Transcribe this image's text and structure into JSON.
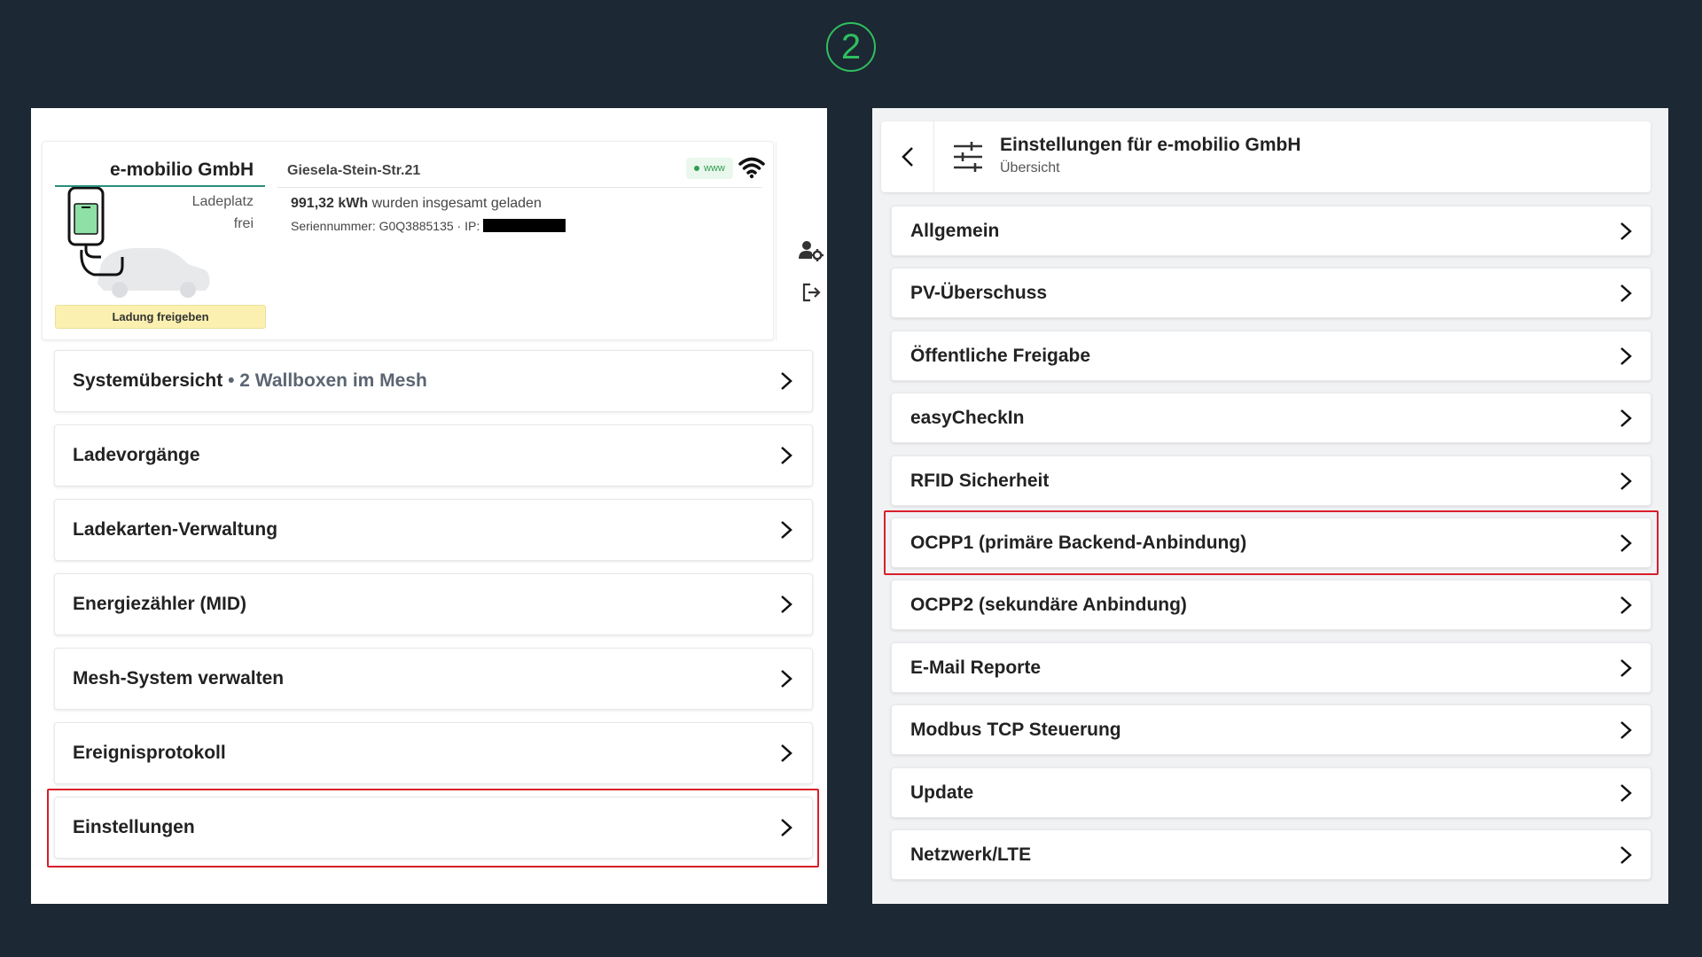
{
  "step": {
    "number": "2"
  },
  "station": {
    "name": "e-mobilio GmbH",
    "status_line1": "Ladeplatz",
    "status_line2": "frei",
    "release_button": "Ladung freigeben",
    "address": "Giesela-Stein-Str.21",
    "connection_badge": "www",
    "kwh_value": "991,32 kWh",
    "kwh_text": "wurden insgesamt geladen",
    "serial": "Seriennummer: G0Q3885135 · IP:"
  },
  "left_menu": {
    "items": [
      {
        "label": "Systemübersicht",
        "sub": "• 2 Wallboxen im Mesh"
      },
      {
        "label": "Ladevorgänge"
      },
      {
        "label": "Ladekarten-Verwaltung"
      },
      {
        "label": "Energiezähler (MID)"
      },
      {
        "label": "Mesh-System verwalten"
      },
      {
        "label": "Ereignisprotokoll"
      },
      {
        "label": "Einstellungen"
      }
    ],
    "highlighted": "Einstellungen"
  },
  "settings": {
    "title": "Einstellungen für e-mobilio GmbH",
    "subtitle": "Übersicht",
    "items": [
      {
        "label": "Allgemein"
      },
      {
        "label": "PV-Überschuss"
      },
      {
        "label": "Öffentliche Freigabe"
      },
      {
        "label": "easyCheckIn"
      },
      {
        "label": "RFID Sicherheit"
      },
      {
        "label": "OCPP1 (primäre Backend-Anbindung)"
      },
      {
        "label": "OCPP2 (sekundäre Anbindung)"
      },
      {
        "label": "E-Mail Reporte"
      },
      {
        "label": "Modbus TCP Steuerung"
      },
      {
        "label": "Update"
      },
      {
        "label": "Netzwerk/LTE"
      }
    ],
    "highlighted": "OCPP1 (primäre Backend-Anbindung)"
  },
  "colors": {
    "background": "#1c2833",
    "step_green": "#2fbf5f",
    "highlight_red": "#d81f2a",
    "release_yellow": "#fbf0b0",
    "accent_teal": "#2a8f7e"
  },
  "icons": [
    "wifi-icon",
    "user-settings-icon",
    "logout-icon",
    "chevron-right-icon",
    "chevron-left-icon",
    "tune-icon",
    "wallbox-icon",
    "car-icon"
  ]
}
